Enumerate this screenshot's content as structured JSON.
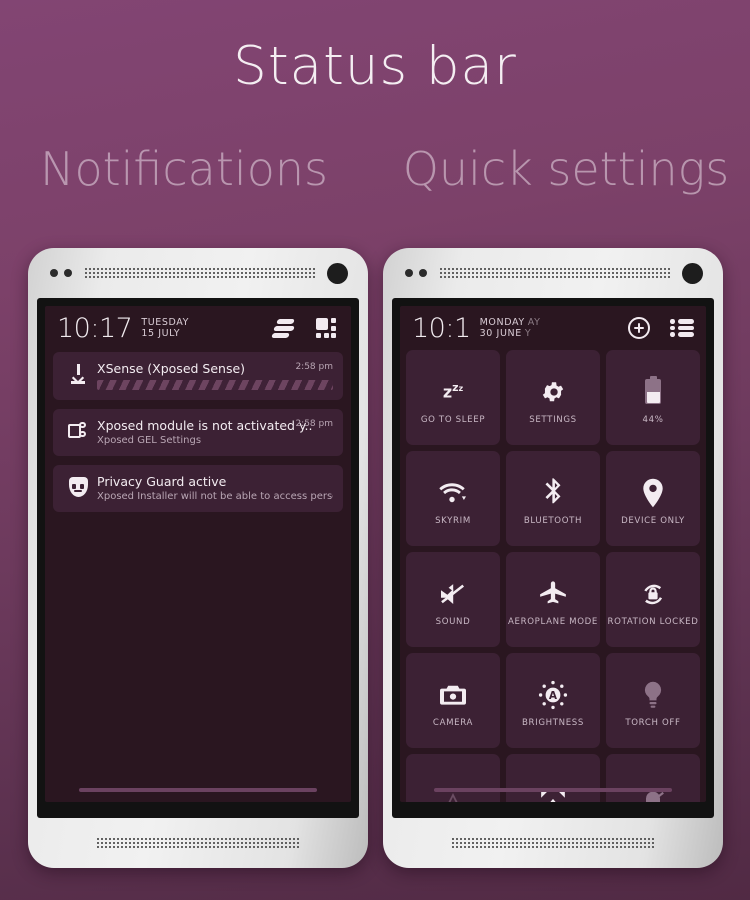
{
  "page": {
    "title": "Status bar",
    "sections": [
      {
        "label": "Notifications"
      },
      {
        "label": "Quick settings"
      }
    ]
  },
  "notifications_phone": {
    "status_bar": {
      "clock": "10:17",
      "date_line1": "TUESDAY",
      "date_line2": "15 JULY",
      "actions": [
        {
          "name": "notifications-list-icon",
          "label": "notifications-list-icon"
        },
        {
          "name": "quick-settings-grid-icon",
          "label": "quick-settings-grid-icon"
        }
      ]
    },
    "items": [
      {
        "icon": "download-icon",
        "title": "XSense (Xposed Sense)",
        "subtitle": "",
        "time": "2:58 pm",
        "progress": true
      },
      {
        "icon": "xposed-module-icon",
        "title": "Xposed module is not activated y..",
        "subtitle": "Xposed GEL Settings",
        "time": "2:58 pm",
        "progress": false
      },
      {
        "icon": "privacy-guard-icon",
        "title": "Privacy Guard active",
        "subtitle": "Xposed Installer will not be able to access personal..",
        "time": "",
        "progress": false
      }
    ]
  },
  "quick_settings_phone": {
    "status_bar": {
      "clock": "10:1",
      "date_line1": "MONDAY",
      "date_line1_ghost": "AY",
      "date_line2": "30 JUNE",
      "date_line2_ghost": "Y",
      "actions": [
        {
          "name": "add-tile-icon",
          "label": "add-tile-icon"
        },
        {
          "name": "list-view-icon",
          "label": "list-view-icon"
        }
      ]
    },
    "tiles": [
      {
        "icon": "sleep-icon",
        "label": "GO TO SLEEP",
        "state": "on"
      },
      {
        "icon": "settings-gear-icon",
        "label": "SETTINGS",
        "state": "on"
      },
      {
        "icon": "battery-icon",
        "label": "44%",
        "state": "on"
      },
      {
        "icon": "wifi-icon",
        "label": "SKYRIM",
        "state": "on"
      },
      {
        "icon": "bluetooth-icon",
        "label": "BLUETOOTH",
        "state": "on"
      },
      {
        "icon": "location-pin-icon",
        "label": "DEVICE ONLY",
        "state": "on"
      },
      {
        "icon": "sound-muted-icon",
        "label": "SOUND",
        "state": "on"
      },
      {
        "icon": "aeroplane-icon",
        "label": "AEROPLANE MODE",
        "state": "on"
      },
      {
        "icon": "rotation-locked-icon",
        "label": "ROTATION LOCKED",
        "state": "on"
      },
      {
        "icon": "camera-icon",
        "label": "CAMERA",
        "state": "on"
      },
      {
        "icon": "brightness-auto-icon",
        "label": "BRIGHTNESS",
        "state": "on"
      },
      {
        "icon": "torch-icon",
        "label": "TORCH OFF",
        "state": "off"
      }
    ],
    "partial_tiles": [
      {
        "icon": "caret-up-icon",
        "label": "",
        "state": "on"
      },
      {
        "icon": "cast-expand-icon",
        "label": "",
        "state": "on"
      },
      {
        "icon": "bell-muted-icon",
        "label": "",
        "state": "off"
      }
    ]
  },
  "colors": {
    "background_top": "#824573",
    "background_bottom": "#512a44",
    "panel": "#2a1620",
    "tile": "#3c2134",
    "text_primary": "#f3ecf1",
    "text_secondary": "#c8b7c4",
    "icon_dim": "#8d7287"
  }
}
